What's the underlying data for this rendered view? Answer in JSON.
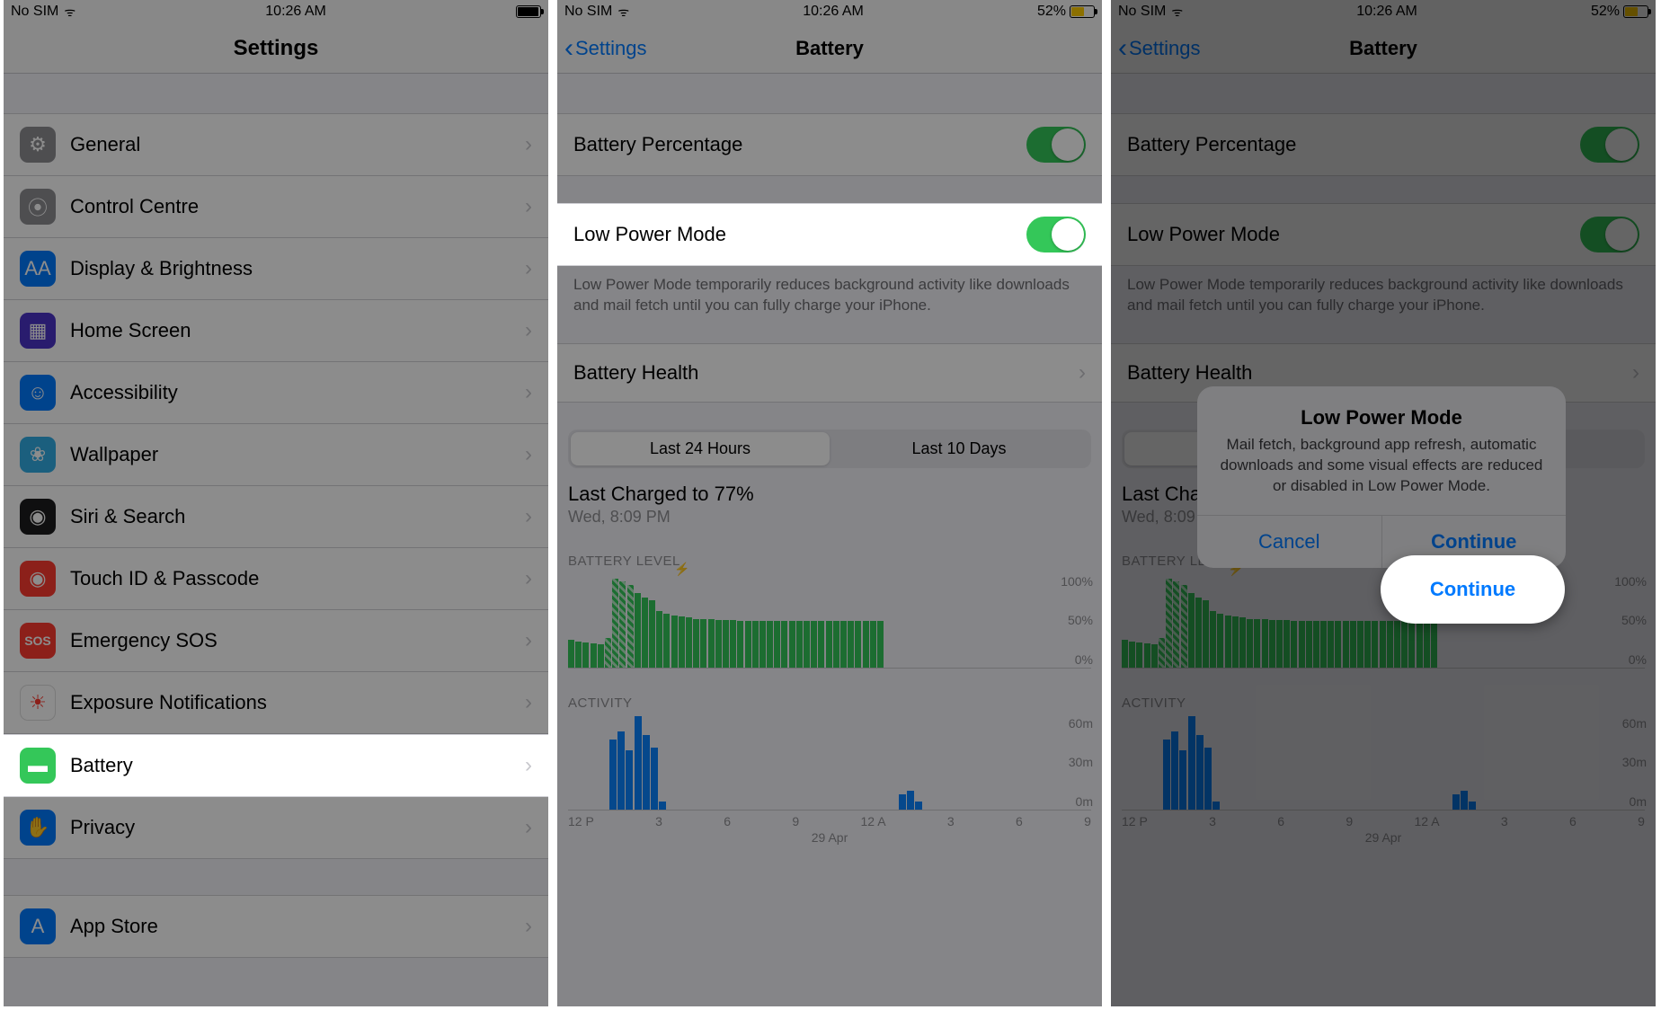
{
  "status": {
    "carrier": "No SIM",
    "time": "10:26 AM",
    "pct": "52%"
  },
  "screen1": {
    "title": "Settings",
    "items": [
      "General",
      "Control Centre",
      "Display & Brightness",
      "Home Screen",
      "Accessibility",
      "Wallpaper",
      "Siri & Search",
      "Touch ID & Passcode",
      "Emergency SOS",
      "Exposure Notifications",
      "Battery",
      "Privacy",
      "App Store"
    ]
  },
  "screen2": {
    "back": "Settings",
    "title": "Battery",
    "batteryPercentage": "Battery Percentage",
    "lowPowerMode": "Low Power Mode",
    "lpmNote": "Low Power Mode temporarily reduces background activity like downloads and mail fetch until you can fully charge your iPhone.",
    "batteryHealth": "Battery Health",
    "seg": {
      "a": "Last 24 Hours",
      "b": "Last 10 Days"
    },
    "lastCharged": "Last Charged to 77%",
    "lastChargedSub": "Wed, 8:09 PM",
    "levelLabel": "BATTERY LEVEL",
    "activityLabel": "ACTIVITY",
    "xticks": [
      "12 P",
      "3",
      "6",
      "9",
      "12 A",
      "3",
      "6",
      "9"
    ],
    "xdate": "29 Apr",
    "yLevels": [
      "100%",
      "50%",
      "0%"
    ],
    "yActivity": [
      "60m",
      "30m",
      "0m"
    ]
  },
  "alert": {
    "title": "Low Power Mode",
    "msg": "Mail fetch, background app refresh, automatic downloads and some visual effects are reduced or disabled in Low Power Mode.",
    "cancel": "Cancel",
    "cont": "Continue"
  },
  "chart_data": [
    {
      "type": "bar",
      "title": "BATTERY LEVEL",
      "ylabel": "%",
      "ylim": [
        0,
        100
      ],
      "x_ticks": [
        "12 P",
        "3",
        "6",
        "9",
        "12 A",
        "3",
        "6",
        "9"
      ],
      "series": [
        {
          "name": "level",
          "values": [
            30,
            28,
            27,
            26,
            25,
            32,
            95,
            92,
            88,
            80,
            75,
            72,
            60,
            58,
            56,
            55,
            54,
            52,
            52,
            52,
            51,
            51,
            51,
            50,
            50,
            50,
            50,
            50,
            50,
            50,
            50,
            50,
            50,
            50,
            50,
            50,
            50,
            50,
            50,
            50,
            50,
            50,
            50
          ]
        },
        {
          "name": "charging_flags",
          "values": [
            0,
            0,
            0,
            0,
            0,
            1,
            1,
            1,
            1,
            0,
            0,
            0,
            0,
            0,
            0,
            0,
            0,
            0,
            0,
            0,
            0,
            0,
            0,
            0,
            0,
            0,
            0,
            0,
            0,
            0,
            0,
            0,
            0,
            0,
            0,
            0,
            0,
            0,
            0,
            0,
            0,
            0,
            0
          ]
        }
      ]
    },
    {
      "type": "bar",
      "title": "ACTIVITY",
      "ylabel": "minutes",
      "ylim": [
        0,
        60
      ],
      "x_ticks": [
        "12 P",
        "3",
        "6",
        "9",
        "12 A",
        "3",
        "6",
        "9"
      ],
      "values": [
        0,
        0,
        0,
        0,
        0,
        45,
        50,
        38,
        60,
        48,
        40,
        5,
        0,
        0,
        0,
        0,
        0,
        0,
        0,
        0,
        0,
        0,
        0,
        0,
        0,
        0,
        0,
        0,
        0,
        0,
        0,
        0,
        0,
        0,
        0,
        0,
        0,
        0,
        0,
        0,
        10,
        12,
        5
      ]
    }
  ]
}
